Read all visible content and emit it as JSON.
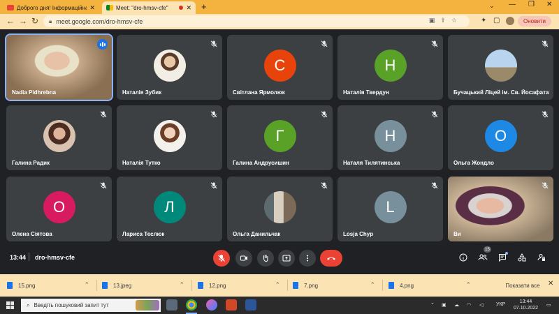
{
  "browser": {
    "tabs": [
      {
        "title": "Доброго дня! Інформаційна пл",
        "close": "✕",
        "active": false
      },
      {
        "title": "Meet: \"dro-hmsv-cfe\"",
        "close": "✕",
        "active": true
      }
    ],
    "new_tab": "+",
    "url": "meet.google.com/dro-hmsv-cfe",
    "update_button": "Оновити"
  },
  "meet": {
    "participants": [
      {
        "name": "Nadia Pidhrebna",
        "kind": "video",
        "speaking": true
      },
      {
        "name": "Наталія Зубик",
        "kind": "photo",
        "muted": true
      },
      {
        "name": "Світлана Ярмолюк",
        "kind": "letter",
        "letter": "С",
        "color": "#e8430a",
        "muted": true
      },
      {
        "name": "Наталія Твердун",
        "kind": "letter",
        "letter": "Н",
        "color": "#5aa127",
        "muted": true
      },
      {
        "name": "Бучацький Ліцей ім. Св. Йосафата",
        "kind": "photo",
        "muted": true
      },
      {
        "name": "Галина Радик",
        "kind": "photo",
        "muted": true
      },
      {
        "name": "Наталія Тутко",
        "kind": "photo",
        "muted": true
      },
      {
        "name": "Галина Андрусишин",
        "kind": "letter",
        "letter": "Г",
        "color": "#5aa127",
        "muted": true
      },
      {
        "name": "Наталя Тилятинська",
        "kind": "letter",
        "letter": "Н",
        "color": "#78909c",
        "muted": true
      },
      {
        "name": "Ольга Жондло",
        "kind": "letter",
        "letter": "О",
        "color": "#1e88e5",
        "muted": true
      },
      {
        "name": "Олена Сіятова",
        "kind": "letter",
        "letter": "О",
        "color": "#d81b60",
        "muted": true
      },
      {
        "name": "Лариса Теслюк",
        "kind": "letter",
        "letter": "Л",
        "color": "#00897b",
        "muted": true
      },
      {
        "name": "Ольга Данильчак",
        "kind": "photo",
        "muted": true
      },
      {
        "name": "Losja Chyp",
        "kind": "letter",
        "letter": "L",
        "color": "#78909c",
        "muted": true
      },
      {
        "name": "Ви",
        "kind": "video",
        "muted": true
      }
    ],
    "time": "13:44",
    "meeting_code": "dro-hmsv-cfe",
    "participant_count": "15"
  },
  "downloads": {
    "files": [
      "15.png",
      "13.jpeg",
      "12.png",
      "7.png",
      "4.png"
    ],
    "show_all": "Показати все",
    "close": "✕"
  },
  "taskbar": {
    "search_placeholder": "Введіть пошуковий запит тут",
    "language": "УКР",
    "time": "13:44",
    "date": "07.10.2022"
  }
}
